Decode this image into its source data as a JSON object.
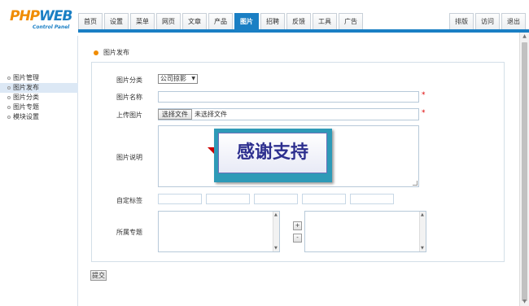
{
  "logo": {
    "php": "PHP",
    "web": "WEB",
    "subtitle": "Control Panel"
  },
  "nav": {
    "tabs": [
      "首页",
      "设置",
      "菜单",
      "网页",
      "文章",
      "产品",
      "图片",
      "招聘",
      "反馈",
      "工具",
      "广告"
    ],
    "active": "图片",
    "right": [
      "排版",
      "访问",
      "退出"
    ]
  },
  "sidebar": {
    "items": [
      "图片管理",
      "图片发布",
      "图片分类",
      "图片专题",
      "模块设置"
    ],
    "active": "图片发布"
  },
  "main": {
    "section_title": "图片发布",
    "form": {
      "category_label": "图片分类",
      "category_value": "公司掠影",
      "name_label": "图片名称",
      "name_value": "",
      "upload_label": "上传图片",
      "file_button": "选择文件",
      "file_status": "未选择文件",
      "desc_label": "图片说明",
      "overlay_text": "感谢支持",
      "tags_label": "自定标签",
      "topic_label": "所属专题",
      "add_button": "+",
      "remove_button": "-",
      "required_mark": "*"
    },
    "submit_label": "提交"
  }
}
